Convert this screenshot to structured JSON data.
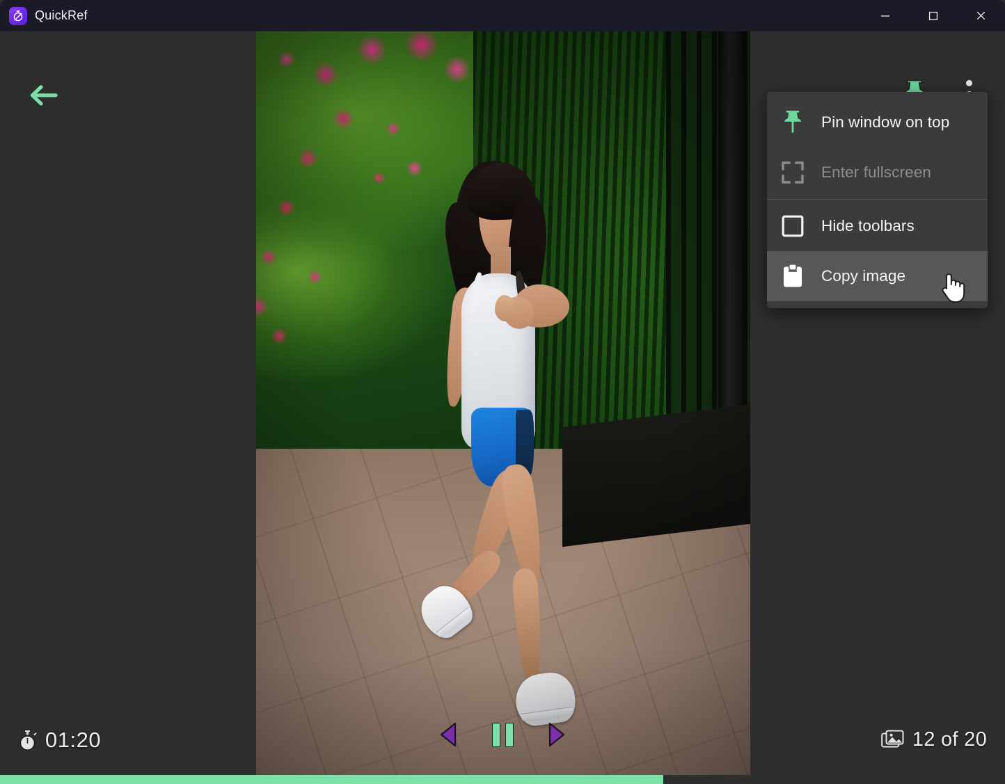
{
  "window": {
    "title": "QuickRef",
    "app_icon": "stopwatch-app-icon",
    "controls": {
      "minimize": "minimize-icon",
      "maximize": "maximize-icon",
      "close": "close-icon"
    }
  },
  "toolbar": {
    "back_label": "back-arrow-icon",
    "pin_label": "pin-icon",
    "more_label": "more-options-icon"
  },
  "menu": {
    "items": [
      {
        "label": "Pin window on top",
        "icon": "pin-icon",
        "state": "enabled",
        "hovered": false
      },
      {
        "label": "Enter fullscreen",
        "icon": "fullscreen-icon",
        "state": "disabled",
        "hovered": false
      },
      {
        "label": "Hide toolbars",
        "icon": "checkbox-unchecked-icon",
        "state": "enabled",
        "hovered": false
      },
      {
        "label": "Copy image",
        "icon": "clipboard-icon",
        "state": "enabled",
        "hovered": true
      }
    ]
  },
  "status": {
    "timer": "01:20",
    "timer_icon": "stopwatch-icon",
    "counter": "12 of 20",
    "counter_icon": "image-stack-icon",
    "current_index": 12,
    "total_images": 20,
    "progress_percent": 66
  },
  "playback": {
    "previous": "previous-arrow-icon",
    "pause": "pause-icon",
    "next": "next-arrow-icon",
    "state": "playing"
  },
  "image": {
    "alt": "Woman in white tank top and blue shorts running on a pavement beside a wall of green foliage with pink bougainvillea flowers"
  },
  "colors": {
    "accent_green": "#7ee0a8",
    "accent_purple": "#7b2fa8",
    "titlebar_bg": "#1b1b28",
    "app_bg": "#2e2e2e",
    "menu_bg": "#3b3b3b",
    "menu_hover_bg": "#575757",
    "text_primary": "#f4f4f4",
    "text_disabled": "#8d8d8d"
  }
}
